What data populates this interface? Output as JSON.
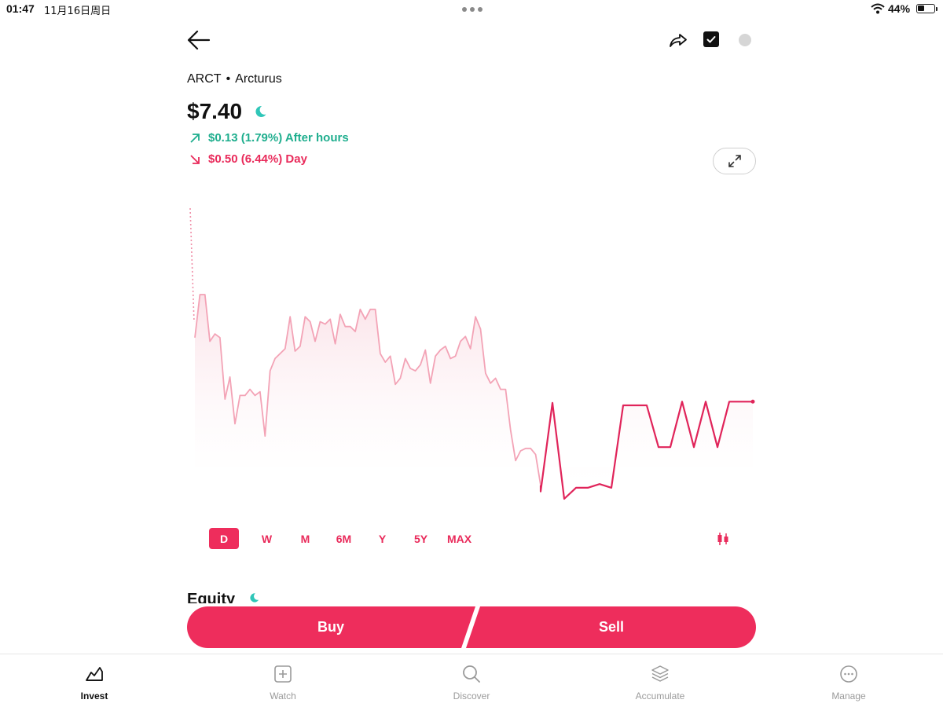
{
  "status": {
    "time": "01:47",
    "date": "11月16日周日",
    "battery": "44%",
    "battery_level": 0.44
  },
  "stock": {
    "symbol": "ARCT",
    "separator": "•",
    "name": "Arcturus",
    "price": "$7.40",
    "after_hours": "$0.13 (1.79%) After hours",
    "day": "$0.50 (6.44%) Day"
  },
  "colors": {
    "up": "#1fae8e",
    "down": "#e92b5b",
    "accent": "#ee2d5c"
  },
  "ranges": [
    "D",
    "W",
    "M",
    "6M",
    "Y",
    "5Y",
    "MAX"
  ],
  "active_range": "D",
  "equity": {
    "title": "Equity"
  },
  "trade": {
    "buy": "Buy",
    "sell": "Sell"
  },
  "tabs": [
    {
      "label": "Invest",
      "icon": "chart-icon",
      "active": true
    },
    {
      "label": "Watch",
      "icon": "plus-square-icon",
      "active": false
    },
    {
      "label": "Discover",
      "icon": "search-icon",
      "active": false
    },
    {
      "label": "Accumulate",
      "icon": "layers-icon",
      "active": false
    },
    {
      "label": "Manage",
      "icon": "more-circle-icon",
      "active": false
    }
  ],
  "chart_data": {
    "type": "line",
    "regular_session": [
      7.75,
      8.1,
      8.1,
      7.72,
      7.78,
      7.75,
      7.25,
      7.43,
      7.05,
      7.28,
      7.28,
      7.33,
      7.28,
      7.31,
      6.95,
      7.48,
      7.58,
      7.62,
      7.66,
      7.92,
      7.64,
      7.68,
      7.92,
      7.88,
      7.72,
      7.88,
      7.86,
      7.9,
      7.7,
      7.94,
      7.84,
      7.84,
      7.8,
      7.98,
      7.9,
      7.98,
      7.98,
      7.62,
      7.55,
      7.6,
      7.37,
      7.42,
      7.58,
      7.5,
      7.48,
      7.53,
      7.65,
      7.38,
      7.6,
      7.65,
      7.68,
      7.58,
      7.6,
      7.72,
      7.76,
      7.66,
      7.92,
      7.82,
      7.46,
      7.38,
      7.42,
      7.33,
      7.33,
      7.0,
      6.75,
      6.83,
      6.85,
      6.85,
      6.8,
      6.55
    ],
    "after_hours": [
      6.5,
      7.22,
      6.44,
      6.53,
      6.53,
      6.56,
      6.53,
      7.2,
      7.2,
      7.2,
      6.86,
      6.86,
      7.23,
      6.86,
      7.23,
      6.86,
      7.23,
      7.23,
      7.23
    ]
  }
}
